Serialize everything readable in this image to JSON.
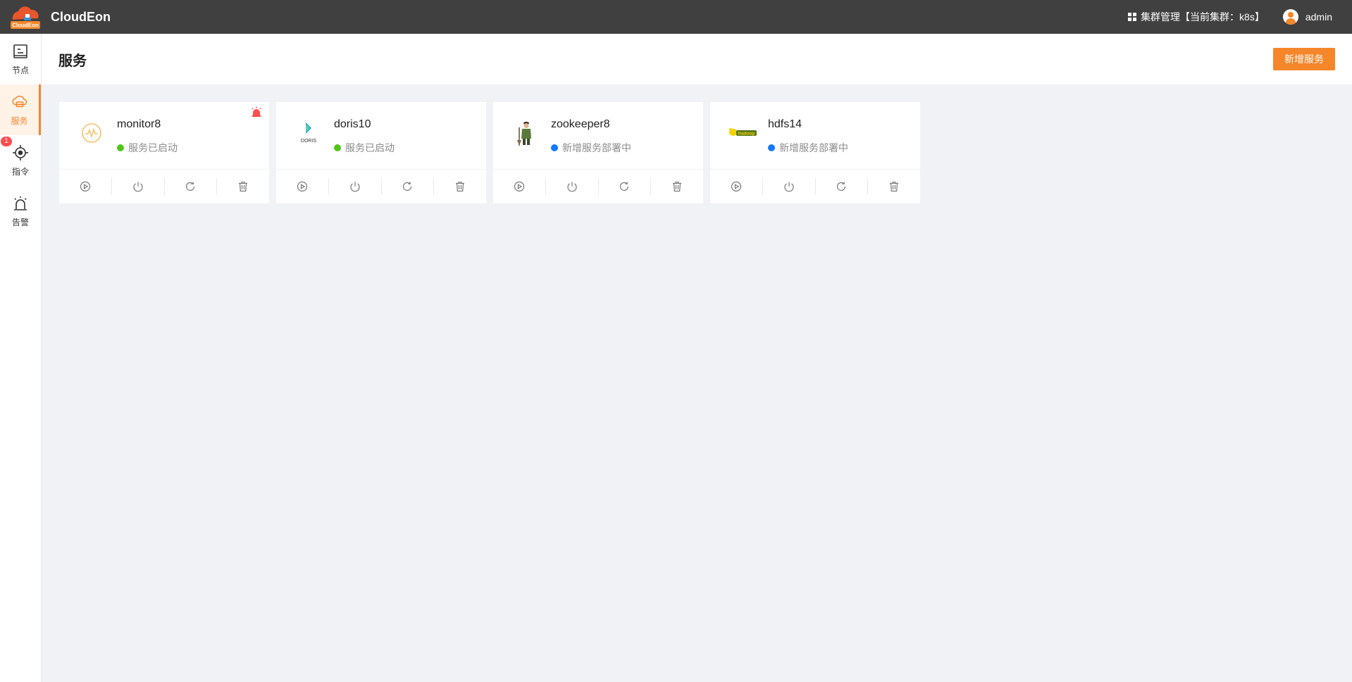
{
  "app": {
    "brand": "CloudEon",
    "logo_text": "CloudEon"
  },
  "topbar": {
    "cluster_label": "集群管理【当前集群：k8s】",
    "username": "admin"
  },
  "sidebar": {
    "items": [
      {
        "label": "节点",
        "icon": "node-icon"
      },
      {
        "label": "服务",
        "icon": "cloud-service-icon",
        "active": true
      },
      {
        "label": "指令",
        "icon": "command-icon",
        "badge": "1"
      },
      {
        "label": "告警",
        "icon": "alarm-icon"
      }
    ]
  },
  "page": {
    "title": "服务",
    "add_button": "新增服务"
  },
  "services": [
    {
      "name": "monitor8",
      "status": "服务已启动",
      "status_color": "#52c41a",
      "logo": "monitor-icon",
      "alert": true
    },
    {
      "name": "doris10",
      "status": "服务已启动",
      "status_color": "#52c41a",
      "logo": "doris-logo",
      "logo_text": "DORIS"
    },
    {
      "name": "zookeeper8",
      "status": "新增服务部署中",
      "status_color": "#1677ff",
      "logo": "zookeeper-logo"
    },
    {
      "name": "hdfs14",
      "status": "新增服务部署中",
      "status_color": "#1677ff",
      "logo": "hadoop-logo",
      "logo_text": "hadoop"
    }
  ],
  "colors": {
    "accent": "#f5862a",
    "topbar": "#404040",
    "alert": "#ff4d4f"
  }
}
